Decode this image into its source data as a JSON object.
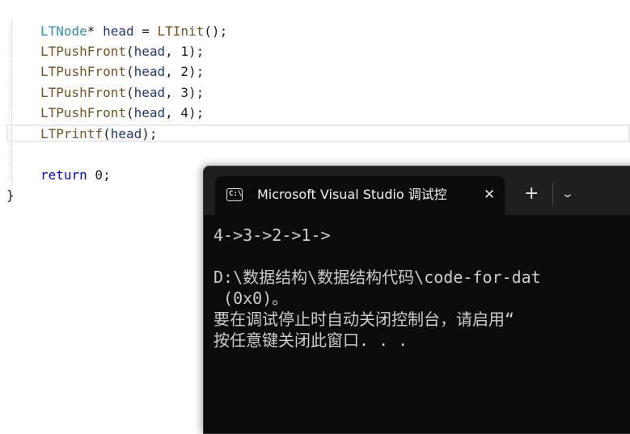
{
  "editor": {
    "line1": {
      "type": "LTNode",
      "rest1": "* ",
      "var": "head",
      "rest2": " = ",
      "call": "LTInit",
      "rest3": "();"
    },
    "line2": {
      "call": "LTPushFront",
      "open": "(",
      "var": "head",
      "args": ", 1);"
    },
    "line3": {
      "call": "LTPushFront",
      "open": "(",
      "var": "head",
      "args": ", 2);"
    },
    "line4": {
      "call": "LTPushFront",
      "open": "(",
      "var": "head",
      "args": ", 3);"
    },
    "line5": {
      "call": "LTPushFront",
      "open": "(",
      "var": "head",
      "args": ", 4);"
    },
    "line6": {
      "call": "LTPrintf",
      "open": "(",
      "var": "head",
      "args": ");"
    },
    "line7": {
      "keyword": "return",
      "rest": " 0;"
    },
    "closing_brace": "}"
  },
  "terminal": {
    "tab_title": "Microsoft Visual Studio 调试控",
    "tab_icon_glyph": "C:\\",
    "tab_close": "✕",
    "new_tab": "+",
    "dropdown": "⌄",
    "output": [
      "4->3->2->1->",
      "",
      "D:\\数据结构\\数据结构代码\\code-for-dat",
      " (0x0)。",
      "要在调试停止时自动关闭控制台，请启用“",
      "按任意键关闭此窗口. . ."
    ]
  }
}
